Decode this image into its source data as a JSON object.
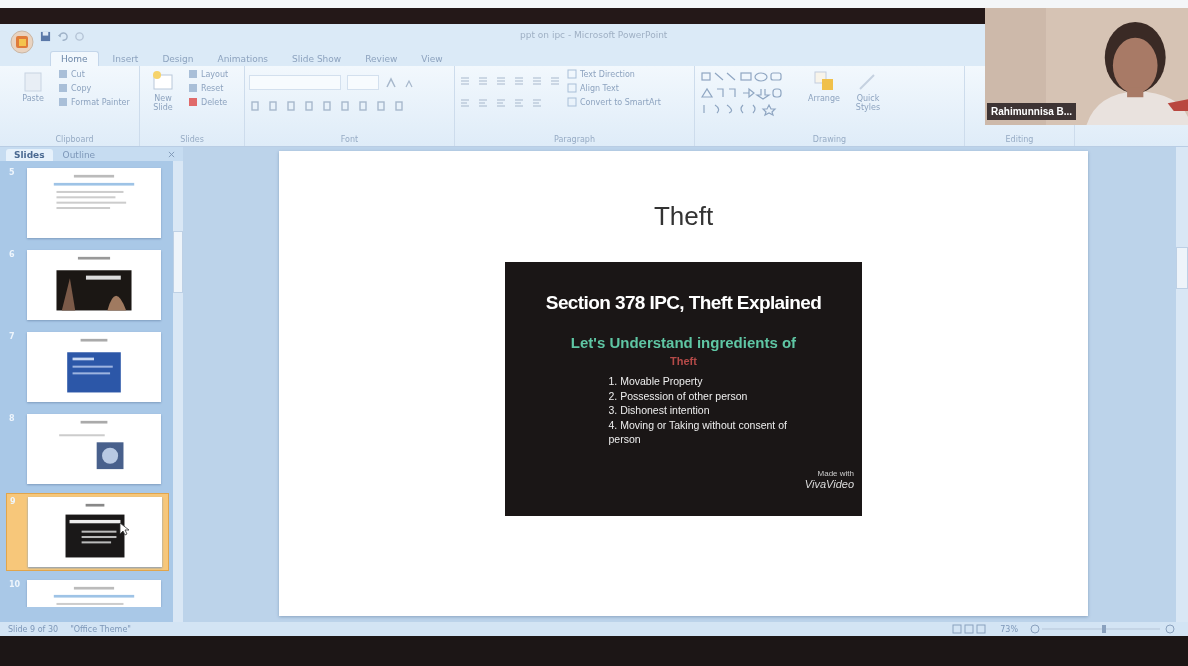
{
  "window": {
    "title": "ppt on ipc - Microsoft PowerPoint"
  },
  "ribbon": {
    "tabs": [
      {
        "label": "Home",
        "selected": true
      },
      {
        "label": "Insert",
        "selected": false
      },
      {
        "label": "Design",
        "selected": false
      },
      {
        "label": "Animations",
        "selected": false
      },
      {
        "label": "Slide Show",
        "selected": false
      },
      {
        "label": "Review",
        "selected": false
      },
      {
        "label": "View",
        "selected": false
      }
    ],
    "groups": [
      {
        "name": "Clipboard",
        "kind": "clipboard",
        "large": "Paste",
        "small": [
          "Cut",
          "Copy",
          "Format Painter"
        ]
      },
      {
        "name": "Slides",
        "kind": "slides",
        "large": "New Slide",
        "small": [
          "Layout",
          "Reset",
          "Delete"
        ]
      },
      {
        "name": "Font",
        "kind": "font"
      },
      {
        "name": "Paragraph",
        "kind": "paragraph",
        "small": [
          "Text Direction",
          "Align Text",
          "Convert to SmartArt"
        ]
      },
      {
        "name": "Drawing",
        "kind": "drawing",
        "large": "Arrange",
        "extra": "Quick Styles"
      },
      {
        "name": "Editing",
        "kind": "editing"
      }
    ]
  },
  "pane": {
    "tabs": [
      {
        "label": "Slides",
        "selected": true
      },
      {
        "label": "Outline",
        "selected": false
      }
    ],
    "thumbnails": [
      {
        "number": "5",
        "kind": "text",
        "selected": false
      },
      {
        "number": "6",
        "selected": false
      },
      {
        "number": "7",
        "kind": "blue",
        "selected": false
      },
      {
        "number": "8",
        "selected": false
      },
      {
        "number": "9",
        "kind": "dark",
        "selected": true
      },
      {
        "number": "10",
        "kind": "text",
        "selected": false
      }
    ]
  },
  "slide": {
    "title": "Theft",
    "panel": {
      "heading": "Section 378 IPC, Theft Explained",
      "subheading": "Let's Understand ingredients of",
      "highlight": "Theft",
      "items": [
        "1. Movable Property",
        "2. Possession of other person",
        "3. Dishonest intention",
        "4. Moving or Taking without consent of person"
      ],
      "credit_small": "Made with",
      "credit": "VivaVideo"
    }
  },
  "status_bar": {
    "slide": "Slide 9 of 30",
    "theme": "\"Office Theme\"",
    "zoom": "73%"
  },
  "video_tile": {
    "name": "Rahimunnisa B..."
  }
}
